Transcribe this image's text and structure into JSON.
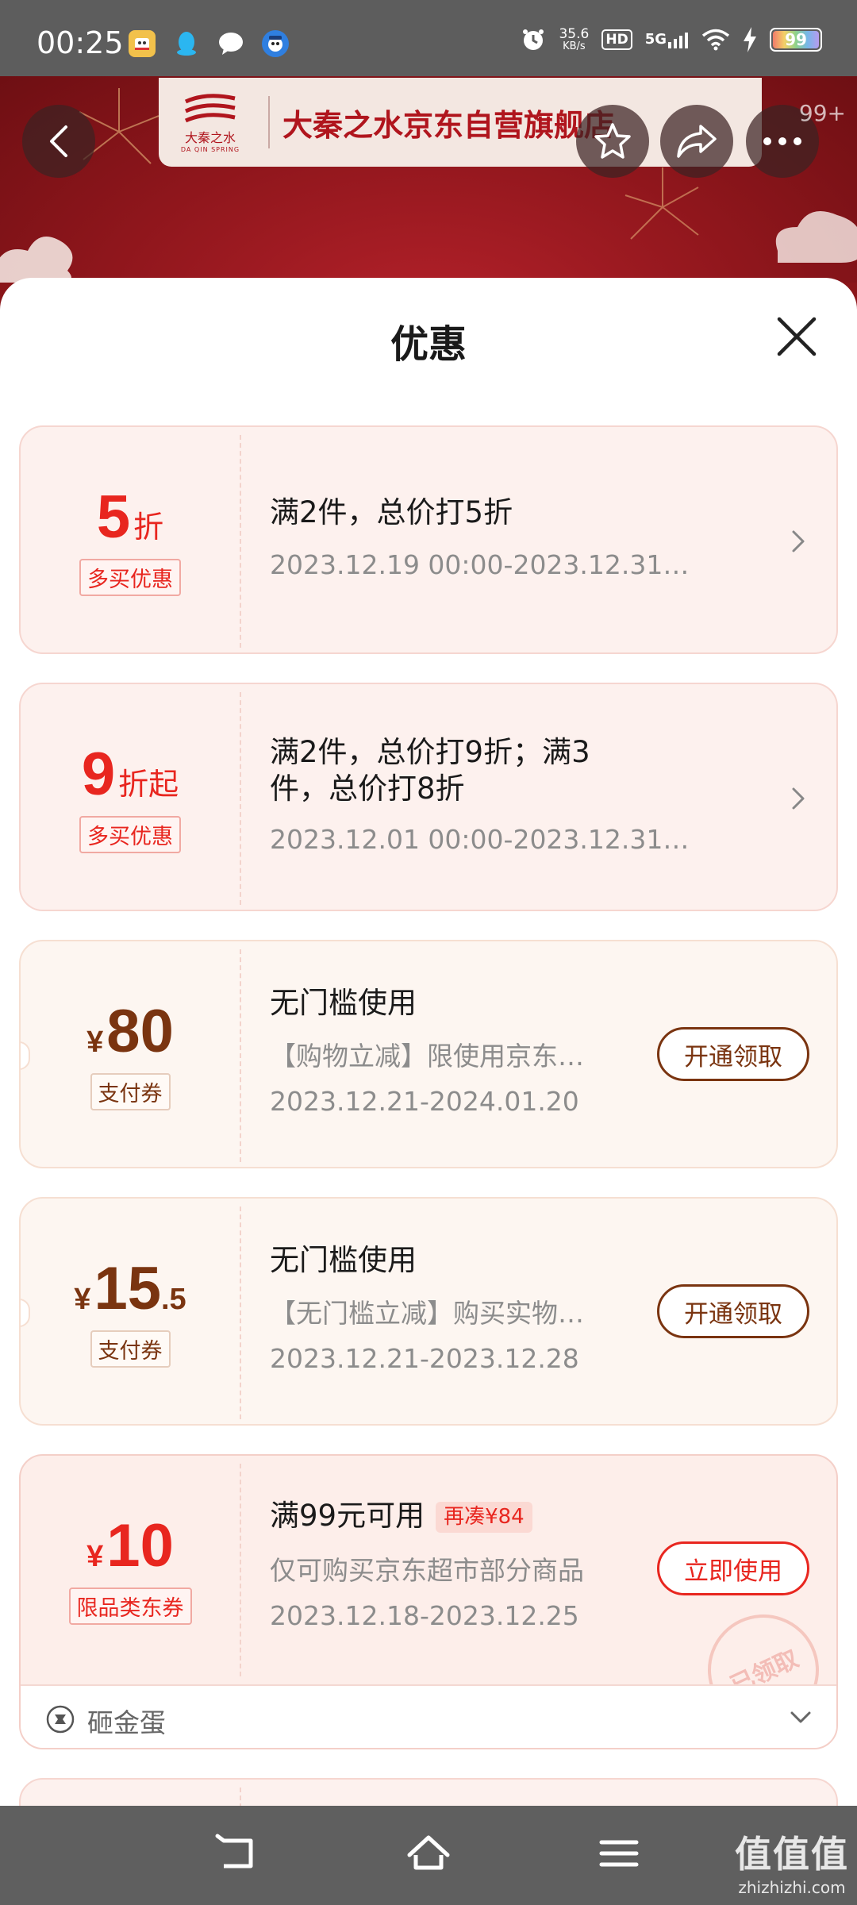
{
  "status_bar": {
    "time": "00:25",
    "net_speed_value": "35.6",
    "net_speed_unit": "KB/s",
    "hd": "HD",
    "network": "5G",
    "battery": "99"
  },
  "store": {
    "name": "大秦之水京东自营旗舰店",
    "logo_cn": "大秦之水",
    "logo_en": "DA QIN SPRING",
    "more_badge": "99+"
  },
  "sheet": {
    "title": "优惠"
  },
  "coupons": [
    {
      "value": "5",
      "unit": "折",
      "tag": "多买优惠",
      "title": "满2件，总价打5折",
      "date": "2023.12.19 00:00-2023.12.31…"
    },
    {
      "value": "9",
      "unit": "折起",
      "tag": "多买优惠",
      "title_line1": "满2件，总价打9折；满3",
      "title_line2": "件，总价打8折",
      "date": "2023.12.01 00:00-2023.12.31…"
    },
    {
      "currency": "¥",
      "value": "80",
      "tag": "支付券",
      "title": "无门槛使用",
      "desc": "【购物立减】限使用京东…",
      "date": "2023.12.21-2024.01.20",
      "button": "开通领取"
    },
    {
      "currency": "¥",
      "value": "15",
      "decimal": ".5",
      "tag": "支付券",
      "title": "无门槛使用",
      "desc": "【无门槛立减】购买实物…",
      "date": "2023.12.21-2023.12.28",
      "button": "开通领取"
    },
    {
      "currency": "¥",
      "value": "10",
      "tag": "限品类东券",
      "title": "满99元可用",
      "extra_tag": "再凑¥84",
      "desc": "仅可购买京东超市部分商品",
      "date": "2023.12.18-2023.12.25",
      "button": "立即使用",
      "stamp": "已领取",
      "footer_label": "砸金蛋"
    }
  ],
  "watermark": {
    "cn": "值值值",
    "en": "zhizhizhi.com"
  }
}
